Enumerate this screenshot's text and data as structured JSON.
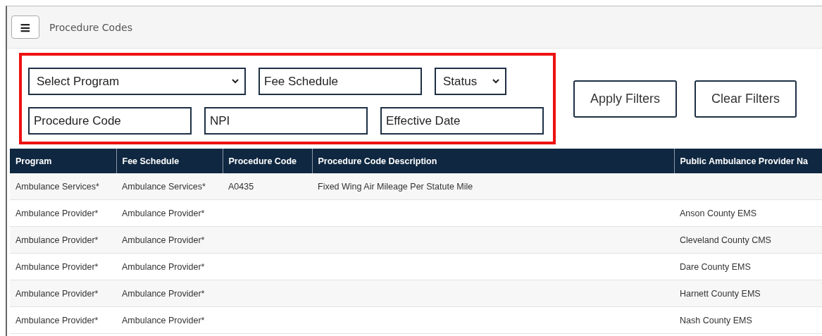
{
  "header": {
    "menu_icon": "≡",
    "title": "Procedure Codes"
  },
  "filters": {
    "rows": [
      [
        {
          "kind": "select",
          "value": "Select Program"
        },
        {
          "kind": "input",
          "placeholder": "Fee Schedule"
        },
        {
          "kind": "select",
          "value": "Status"
        }
      ],
      [
        {
          "kind": "input",
          "placeholder": "Procedure Code"
        },
        {
          "kind": "input",
          "placeholder": "NPI"
        },
        {
          "kind": "input",
          "placeholder": "Effective Date"
        }
      ]
    ],
    "buttons": [
      "Apply Filters",
      "Clear Filters"
    ]
  },
  "table": {
    "columns": [
      "Program",
      "Fee Schedule",
      "Procedure Code",
      "Procedure Code Description",
      "Public Ambulance Provider Na"
    ],
    "rows": [
      [
        "Ambulance Services*",
        "Ambulance Services*",
        "A0435",
        "Fixed Wing Air Mileage Per Statute Mile",
        null
      ],
      [
        "Ambulance Provider*",
        "Ambulance Provider*",
        null,
        null,
        "Anson County EMS"
      ],
      [
        "Ambulance Provider*",
        "Ambulance Provider*",
        null,
        null,
        "Cleveland County CMS"
      ],
      [
        "Ambulance Provider*",
        "Ambulance Provider*",
        null,
        null,
        "Dare County EMS"
      ],
      [
        "Ambulance Provider*",
        "Ambulance Provider*",
        null,
        null,
        "Harnett County EMS"
      ],
      [
        "Ambulance Provider*",
        "Ambulance Provider*",
        null,
        null,
        "Nash County EMS"
      ]
    ]
  }
}
